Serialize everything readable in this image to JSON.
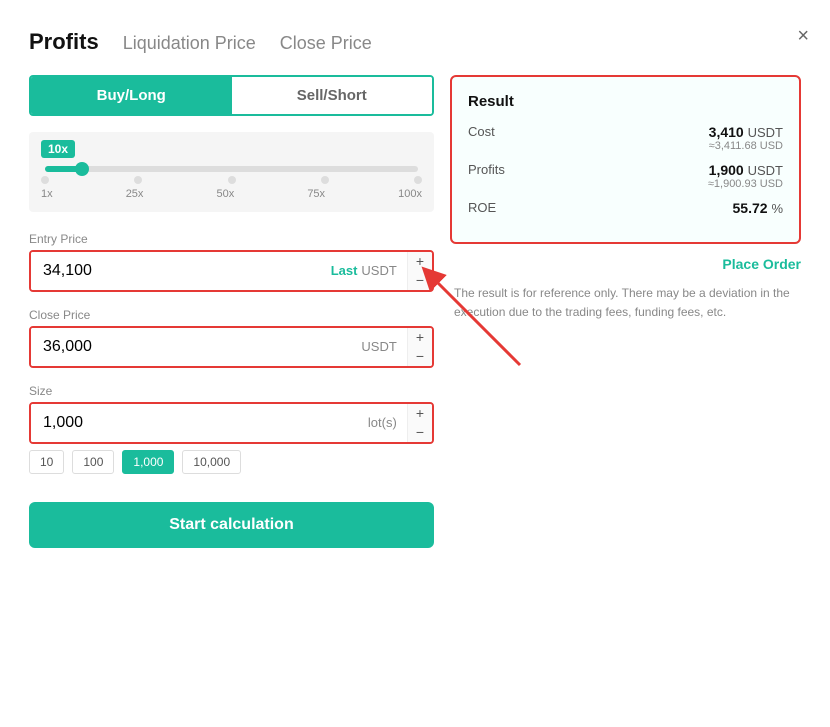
{
  "modal": {
    "close_label": "×"
  },
  "tabs": [
    {
      "label": "Profits",
      "active": true
    },
    {
      "label": "Liquidation Price",
      "active": false
    },
    {
      "label": "Close Price",
      "active": false
    }
  ],
  "toggle": {
    "buy_label": "Buy/Long",
    "sell_label": "Sell/Short"
  },
  "leverage": {
    "badge": "10x",
    "marks": [
      "1x",
      "25x",
      "50x",
      "75x",
      "100x"
    ]
  },
  "entry_price": {
    "label": "Entry Price",
    "value": "34,100",
    "last_label": "Last",
    "unit": "USDT"
  },
  "close_price": {
    "label": "Close Price",
    "value": "36,000",
    "unit": "USDT"
  },
  "size": {
    "label": "Size",
    "value": "1,000",
    "unit": "lot(s)",
    "presets": [
      "10",
      "100",
      "1,000",
      "10,000"
    ]
  },
  "start_btn": "Start calculation",
  "result": {
    "title": "Result",
    "cost_label": "Cost",
    "cost_value": "3,410",
    "cost_unit": "USDT",
    "cost_sub": "≈3,411.68 USD",
    "profits_label": "Profits",
    "profits_value": "1,900",
    "profits_unit": "USDT",
    "profits_sub": "≈1,900.93 USD",
    "roe_label": "ROE",
    "roe_value": "55.72",
    "roe_unit": "%",
    "place_order_label": "Place Order"
  },
  "disclaimer": "The result is for reference only. There may be a deviation in the execution due to the trading fees, funding fees, etc."
}
